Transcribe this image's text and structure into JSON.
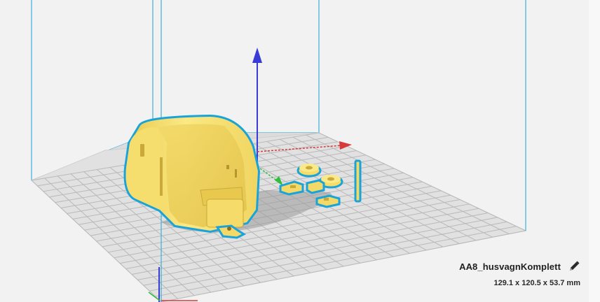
{
  "object": {
    "name": "AA8_husvagnKomplett",
    "dimensions": "129.1 x 120.5 x 53.7 mm"
  },
  "icons": {
    "edit": "pencil-icon"
  },
  "colors": {
    "background": "#f2f2f2",
    "build_volume_edges": "#3ab0d8",
    "model_fill": "#f7e27a",
    "model_selection_outline": "#1aa3d9",
    "x_axis": "#d63a3a",
    "y_axis": "#2fbf3a",
    "z_axis": "#3a3ad6"
  }
}
